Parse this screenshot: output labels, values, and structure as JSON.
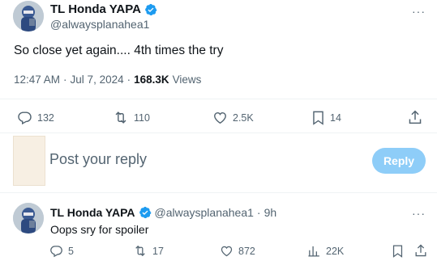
{
  "tweet": {
    "author_name": "TL Honda YAPA",
    "author_handle": "@alwaysplanahea1",
    "text": "So close yet again.... 4th times the try",
    "time": "12:47 AM",
    "date": "Jul 7, 2024",
    "views_count": "168.3K",
    "views_label": "Views",
    "more_label": "···",
    "actions": {
      "replies": "132",
      "reposts": "110",
      "likes": "2.5K",
      "bookmarks": "14"
    }
  },
  "composer": {
    "placeholder": "Post your reply",
    "reply_button": "Reply"
  },
  "reply": {
    "author_name": "TL Honda YAPA",
    "author_handle": "@alwaysplanahea1",
    "separator": "·",
    "time": "9h",
    "text": "Oops sry for spoiler",
    "more_label": "···",
    "actions": {
      "replies": "5",
      "reposts": "17",
      "likes": "872",
      "views": "22K"
    }
  },
  "icons": {
    "verified": "verified-badge-icon",
    "reply": "reply-icon",
    "repost": "repost-icon",
    "like": "heart-icon",
    "bookmark": "bookmark-icon",
    "share": "share-icon",
    "views": "views-icon",
    "more": "more-icon"
  },
  "colors": {
    "accent": "#1d9bf0",
    "reply_button": "#8ecdf8",
    "secondary_text": "#536471",
    "divider": "#eff3f4"
  }
}
